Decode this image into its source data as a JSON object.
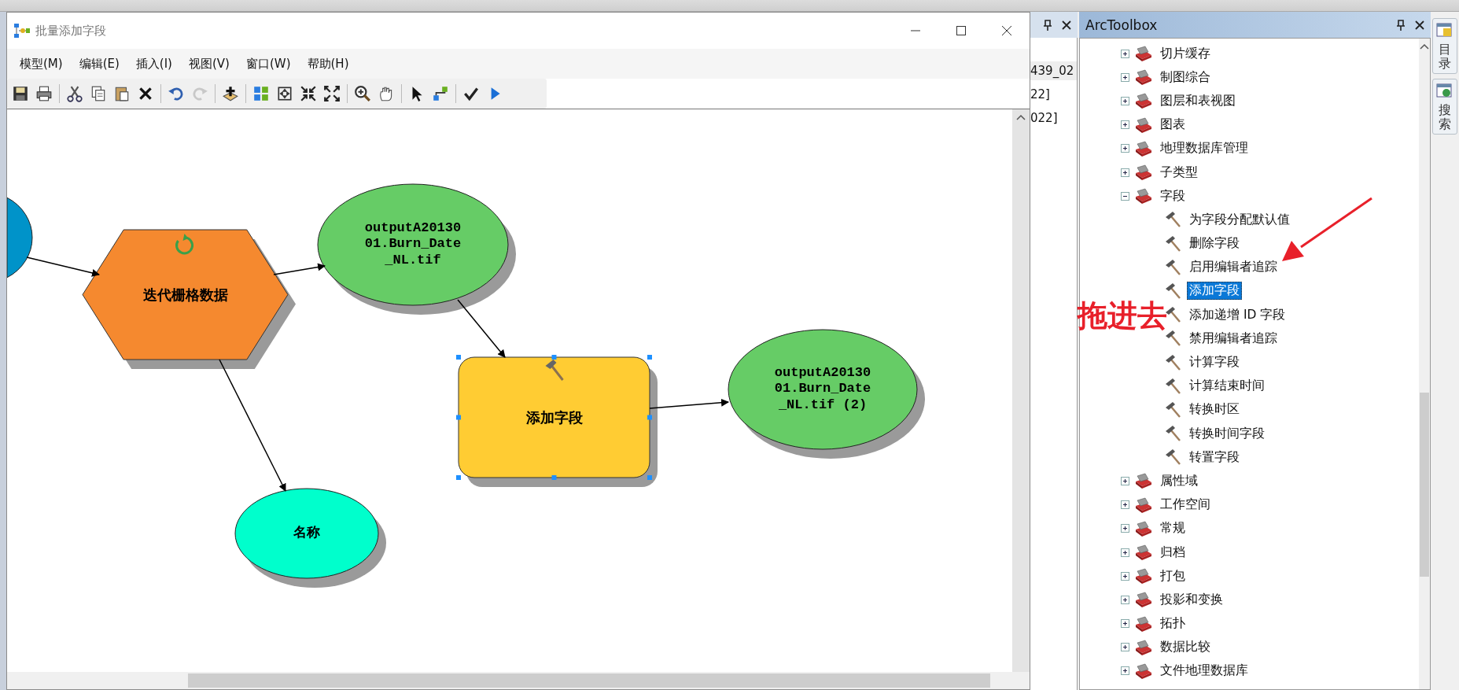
{
  "window": {
    "title": "批量添加字段"
  },
  "menu": [
    "模型(M)",
    "编辑(E)",
    "插入(I)",
    "视图(V)",
    "窗口(W)",
    "帮助(H)"
  ],
  "model": {
    "nodes": [
      {
        "kind": "ellipse",
        "color": "#0093c9",
        "selected": false
      },
      {
        "kind": "iterator",
        "label": "迭代栅格数据",
        "color": "#f5892f",
        "selected": false
      },
      {
        "kind": "ellipse",
        "label": "outputA2013001.Burn_Date_NL.tif",
        "color": "#66cc66",
        "selected": false
      },
      {
        "kind": "tool",
        "label": "添加字段",
        "color": "#ffcc33",
        "selected": true
      },
      {
        "kind": "ellipse",
        "label": "outputA2013001.Burn_Date_NL.tif (2)",
        "color": "#66cc66",
        "selected": false
      },
      {
        "kind": "ellipse",
        "label": "名称",
        "color": "#00ffcc",
        "selected": false
      }
    ]
  },
  "behind_panel": {
    "lines": [
      "439_02",
      "22]",
      "022]"
    ]
  },
  "toolbox": {
    "title": "ArcToolbox",
    "items": [
      {
        "kind": "toolset",
        "label": "切片缓存",
        "expanded": false,
        "selected": false
      },
      {
        "kind": "toolset",
        "label": "制图综合",
        "expanded": false,
        "selected": false
      },
      {
        "kind": "toolset",
        "label": "图层和表视图",
        "expanded": false,
        "selected": false
      },
      {
        "kind": "toolset",
        "label": "图表",
        "expanded": false,
        "selected": false
      },
      {
        "kind": "toolset",
        "label": "地理数据库管理",
        "expanded": false,
        "selected": false
      },
      {
        "kind": "toolset",
        "label": "子类型",
        "expanded": false,
        "selected": false
      },
      {
        "kind": "toolset",
        "label": "字段",
        "expanded": true,
        "selected": false,
        "children": [
          {
            "kind": "tool",
            "label": "为字段分配默认值",
            "selected": false
          },
          {
            "kind": "tool",
            "label": "删除字段",
            "selected": false
          },
          {
            "kind": "tool",
            "label": "启用编辑者追踪",
            "selected": false
          },
          {
            "kind": "tool",
            "label": "添加字段",
            "selected": true
          },
          {
            "kind": "tool",
            "label": "添加递增 ID 字段",
            "selected": false
          },
          {
            "kind": "tool",
            "label": "禁用编辑者追踪",
            "selected": false
          },
          {
            "kind": "tool",
            "label": "计算字段",
            "selected": false
          },
          {
            "kind": "tool",
            "label": "计算结束时间",
            "selected": false
          },
          {
            "kind": "tool",
            "label": "转换时区",
            "selected": false
          },
          {
            "kind": "tool",
            "label": "转换时间字段",
            "selected": false
          },
          {
            "kind": "tool",
            "label": "转置字段",
            "selected": false
          }
        ]
      },
      {
        "kind": "toolset",
        "label": "属性域",
        "expanded": false,
        "selected": false
      },
      {
        "kind": "toolset",
        "label": "工作空间",
        "expanded": false,
        "selected": false
      },
      {
        "kind": "toolset",
        "label": "常规",
        "expanded": false,
        "selected": false
      },
      {
        "kind": "toolset",
        "label": "归档",
        "expanded": false,
        "selected": false
      },
      {
        "kind": "toolset",
        "label": "打包",
        "expanded": false,
        "selected": false
      },
      {
        "kind": "toolset",
        "label": "投影和变换",
        "expanded": false,
        "selected": false
      },
      {
        "kind": "toolset",
        "label": "拓扑",
        "expanded": false,
        "selected": false
      },
      {
        "kind": "toolset",
        "label": "数据比较",
        "expanded": false,
        "selected": false
      },
      {
        "kind": "toolset",
        "label": "文件地理数据库",
        "expanded": false,
        "selected": false
      }
    ]
  },
  "side_tabs": [
    "目录",
    "搜索"
  ],
  "annotation": {
    "text": "拖进去"
  }
}
